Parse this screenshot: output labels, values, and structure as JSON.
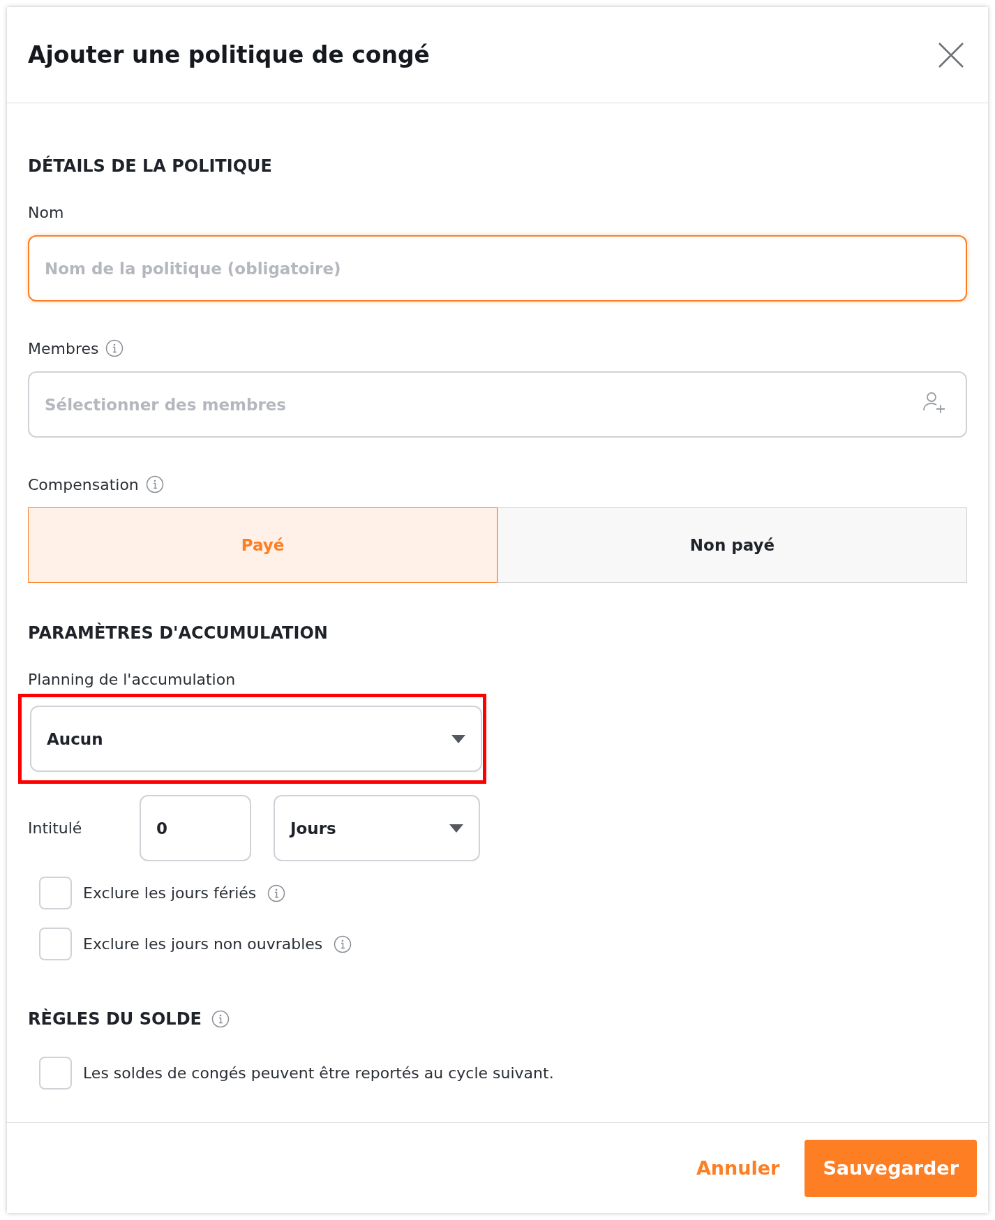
{
  "dialog": {
    "title": "Ajouter une politique de congé"
  },
  "sections": [
    {
      "kind": "details",
      "title": "DÉTAILS DE LA POLITIQUE",
      "name_field": {
        "label": "Nom",
        "placeholder": "Nom de la politique (obligatoire)",
        "focused": true
      },
      "members_field": {
        "label": "Membres",
        "placeholder": "Sélectionner des membres"
      },
      "compensation": {
        "label": "Compensation",
        "options": [
          {
            "label": "Payé",
            "selected": true
          },
          {
            "label": "Non payé",
            "selected": false
          }
        ]
      }
    },
    {
      "kind": "accrual",
      "title": "PARAMÈTRES D'ACCUMULATION",
      "schedule": {
        "label": "Planning de l'accumulation",
        "value": "Aucun",
        "highlighted": true
      },
      "amount": {
        "label": "Intitulé",
        "value": "0",
        "unit": "Jours"
      },
      "checkboxes": [
        {
          "label": "Exclure les jours fériés",
          "checked": false,
          "info": true
        },
        {
          "label": "Exclure les jours non ouvrables",
          "checked": false,
          "info": true
        }
      ]
    },
    {
      "kind": "balance",
      "title": "RÈGLES DU SOLDE",
      "checkboxes": [
        {
          "label": "Les soldes de congés peuvent être reportés au cycle suivant.",
          "checked": false,
          "info": false
        }
      ]
    }
  ],
  "footer": {
    "buttons": [
      {
        "label": "Annuler",
        "kind": "link"
      },
      {
        "label": "Sauvegarder",
        "kind": "primary"
      }
    ]
  }
}
